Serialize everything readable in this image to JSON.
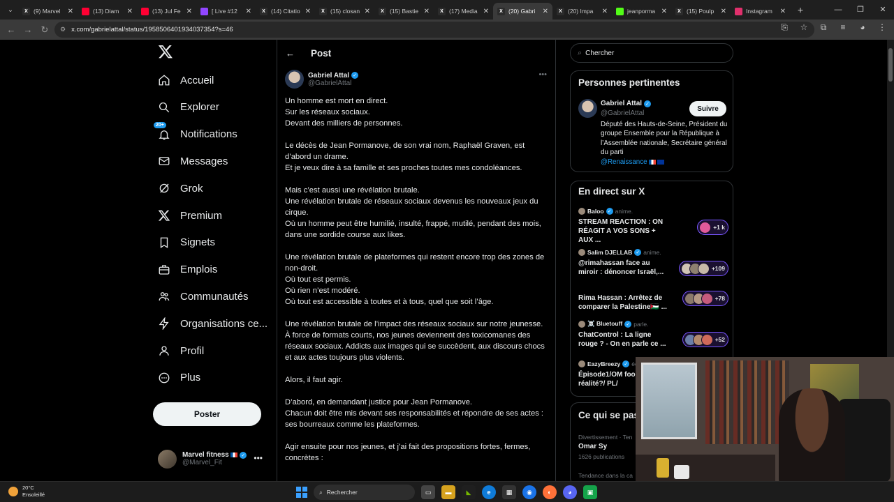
{
  "browser": {
    "tabs": [
      {
        "title": "(9) Marvel",
        "icon": "x-favicon",
        "color": "#2b2b2b"
      },
      {
        "title": "(13) Diam",
        "icon": "youtube-favicon",
        "color": "#ff0033"
      },
      {
        "title": "(13) Jul Fe",
        "icon": "youtube-favicon",
        "color": "#ff0033"
      },
      {
        "title": "[ Live #12",
        "icon": "twitch-favicon",
        "color": "#9146ff"
      },
      {
        "title": "(14) Citatio",
        "icon": "x-favicon",
        "color": "#2b2b2b"
      },
      {
        "title": "(15) closan",
        "icon": "x-favicon",
        "color": "#2b2b2b"
      },
      {
        "title": "(15) Bastie",
        "icon": "x-favicon",
        "color": "#2b2b2b"
      },
      {
        "title": "(17) Media",
        "icon": "x-favicon",
        "color": "#2b2b2b"
      },
      {
        "title": "(20) Gabri",
        "icon": "x-favicon",
        "color": "#2b2b2b",
        "active": true
      },
      {
        "title": "(20) Impa",
        "icon": "x-favicon",
        "color": "#2b2b2b"
      },
      {
        "title": "jeanporma",
        "icon": "kick-favicon",
        "color": "#53fc18"
      },
      {
        "title": "(15) Poulp",
        "icon": "x-favicon",
        "color": "#2b2b2b"
      },
      {
        "title": "Instagram",
        "icon": "instagram-favicon",
        "color": "#e1306c"
      }
    ],
    "url": "x.com/gabrielattal/status/1958506401934037354?s=46"
  },
  "nav": {
    "items": [
      {
        "label": "Accueil",
        "icon": "home-icon"
      },
      {
        "label": "Explorer",
        "icon": "search-icon"
      },
      {
        "label": "Notifications",
        "icon": "bell-icon",
        "badge": "20+"
      },
      {
        "label": "Messages",
        "icon": "mail-icon"
      },
      {
        "label": "Grok",
        "icon": "grok-icon"
      },
      {
        "label": "Premium",
        "icon": "x-logo-icon"
      },
      {
        "label": "Signets",
        "icon": "bookmark-icon"
      },
      {
        "label": "Emplois",
        "icon": "briefcase-icon"
      },
      {
        "label": "Communautés",
        "icon": "people-icon"
      },
      {
        "label": "Organisations ce...",
        "icon": "lightning-icon"
      },
      {
        "label": "Profil",
        "icon": "person-icon"
      },
      {
        "label": "Plus",
        "icon": "more-circle-icon"
      }
    ],
    "post_button": "Poster",
    "me": {
      "name": "Marvel fitness",
      "handle": "@Marvel_Fit"
    }
  },
  "post": {
    "header_title": "Post",
    "author_name": "Gabriel Attal",
    "author_handle": "@GabrielAttal",
    "paragraphs": [
      [
        "Un homme est mort en direct.",
        "Sur les réseaux sociaux.",
        "Devant des milliers de personnes."
      ],
      [
        "Le décès de Jean Pormanove, de son vrai nom, Raphaël Graven, est d’abord un drame.",
        "Et je veux dire à sa famille et ses proches toutes mes condoléances."
      ],
      [
        "Mais c’est aussi une révélation brutale.",
        "Une révélation brutale de réseaux sociaux devenus les nouveaux jeux du cirque.",
        "Où un homme peut être humilié, insulté, frappé, mutilé, pendant des mois, dans une sordide course aux likes."
      ],
      [
        "Une révélation brutale de plateformes qui restent encore trop des zones de non-droit.",
        "Où tout est permis.",
        "Où rien n’est modéré.",
        "Où tout est accessible à toutes et à tous, quel que soit l’âge."
      ],
      [
        "Une révélation brutale de l’impact des réseaux sociaux sur notre jeunesse.",
        "À force de formats courts, nos jeunes deviennent des toxicomanes des réseaux sociaux. Addicts aux images qui se succèdent, aux discours chocs et aux actes toujours plus violents."
      ],
      [
        "Alors, il faut agir."
      ],
      [
        "D’abord, en demandant justice pour Jean Pormanove.",
        "Chacun doit être mis devant ses responsabilités et répondre de ses actes : ses bourreaux comme les plateformes."
      ],
      [
        "Agir ensuite pour nos jeunes, et j’ai fait des propositions fortes, fermes, concrètes :"
      ]
    ]
  },
  "right": {
    "search_placeholder": "Chercher",
    "related_title": "Personnes pertinentes",
    "related": {
      "name": "Gabriel Attal",
      "handle": "@GabrielAttal",
      "follow": "Suivre",
      "bio": "Député des Hauts-de-Seine, Président du groupe Ensemble pour la République à l’Assemblée nationale, Secrétaire général du parti",
      "bio_link": "@Renaissance"
    },
    "live_title": "En direct sur X",
    "live": [
      {
        "host": "Baloo",
        "action": "anime.",
        "title": "STREAM REACTION : ON RÉAGIT A VOS SONS + AUX ...",
        "count": "+1 k"
      },
      {
        "host": "Salim DJELLAB",
        "action": "anime.",
        "title": "@rimahassan face au miroir : dénoncer Israël,...",
        "count": "+109"
      },
      {
        "host": "",
        "action": "",
        "title": "Rima Hassan : Arrêtez de comparer la Palestine🇵🇸 ...",
        "count": "+78"
      },
      {
        "host": "☠️ Bluetouff",
        "action": "parle.",
        "title": "ChatControl : La ligne rouge ? - On en parle ce ...",
        "count": "+52"
      },
      {
        "host": "EazyBreezy",
        "action": "écou",
        "title": "Épisode1/OM foo télé-réalité?/ PL/",
        "count": ""
      }
    ],
    "trends_title": "Ce qui se pas",
    "trends": [
      {
        "category": "Divertissement · Ten",
        "name": "Omar Sy",
        "posts": "1626 publications"
      },
      {
        "category": "Tendance dans la ca",
        "name": "",
        "posts": ""
      }
    ]
  },
  "taskbar": {
    "temp": "20°C",
    "condition": "Ensoleillé",
    "search": "Rechercher"
  }
}
